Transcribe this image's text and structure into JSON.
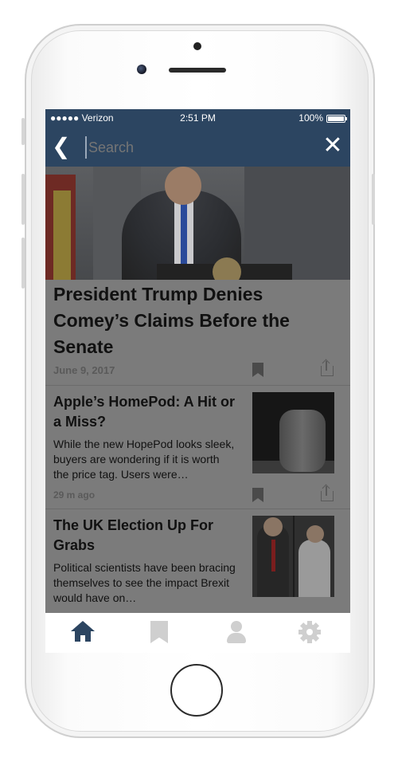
{
  "status_bar": {
    "carrier": "●●●●● Verizon",
    "time": "2:51 PM",
    "battery": "100%"
  },
  "search": {
    "placeholder": "Search",
    "back_icon": "chevron-left-icon",
    "close_icon": "close-icon"
  },
  "hero_article": {
    "title": "President Trump Denies Comey’s Claims Before the Senate",
    "date": "June 9, 2017"
  },
  "articles": [
    {
      "title": "Apple’s HomePod: A Hit or a Miss?",
      "summary": "While the new HopePod looks sleek, buyers are wondering if it is worth the price tag. Users were…",
      "meta": "29 m ago"
    },
    {
      "title": "The UK Election Up For Grabs",
      "summary": "Political scientists have been bracing themselves to see the impact Brexit would have on…",
      "meta": ""
    }
  ],
  "tab_bar": {
    "tabs": [
      {
        "id": "home",
        "icon": "home-icon",
        "active": true
      },
      {
        "id": "bookmarks",
        "icon": "bookmark-icon",
        "active": false
      },
      {
        "id": "profile",
        "icon": "profile-icon",
        "active": false
      },
      {
        "id": "settings",
        "icon": "gear-icon",
        "active": false
      }
    ]
  },
  "colors": {
    "nav_bar": "#2c4561",
    "overlay": "#7b7b7b",
    "active_tab": "#2c4561",
    "inactive_tab": "#cfcfcf"
  }
}
